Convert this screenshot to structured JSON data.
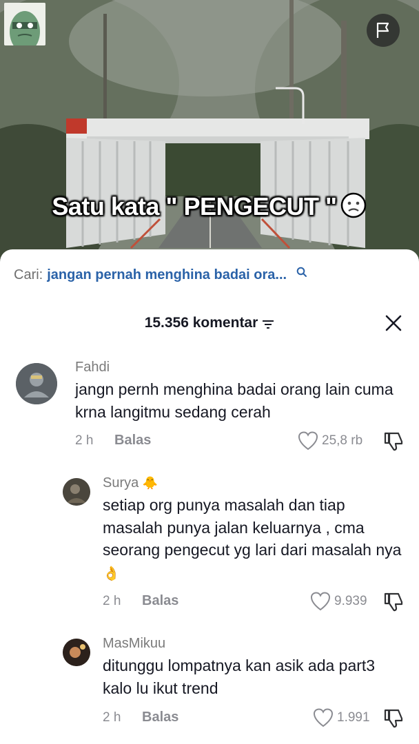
{
  "video": {
    "caption_text": "Satu kata \" PENGECUT \"",
    "caption_emoji_icon": "confused-face-icon",
    "flag_icon": "flag-icon"
  },
  "search": {
    "prefix": "Cari:",
    "query": "jangan pernah menghina badai ora...",
    "icon": "search-icon"
  },
  "comments_header": {
    "count_label": "15.356 komentar",
    "sort_icon": "sort-icon",
    "close_icon": "close-icon"
  },
  "comments": [
    {
      "username": "Fahdi",
      "text": "jangn pernh menghina badai orang lain cuma krna langitmu sedang cerah",
      "time": "2 h",
      "reply_label": "Balas",
      "likes": "25,8 rb"
    },
    {
      "username": "Surya",
      "username_emoji": "🐥",
      "text": "setiap org punya masalah dan tiap masalah punya jalan keluarnya , cma seorang pengecut yg lari dari masalah nya",
      "text_emoji": "👌",
      "time": "2 h",
      "reply_label": "Balas",
      "likes": "9.939"
    },
    {
      "username": "MasMikuu",
      "text": "ditunggu lompatnya kan asik ada part3 kalo lu ikut trend",
      "time": "2 h",
      "reply_label": "Balas",
      "likes": "1.991"
    }
  ],
  "colors": {
    "search_query": "#2a62a8",
    "text_primary": "#161823",
    "text_secondary": "#8a8b91"
  }
}
